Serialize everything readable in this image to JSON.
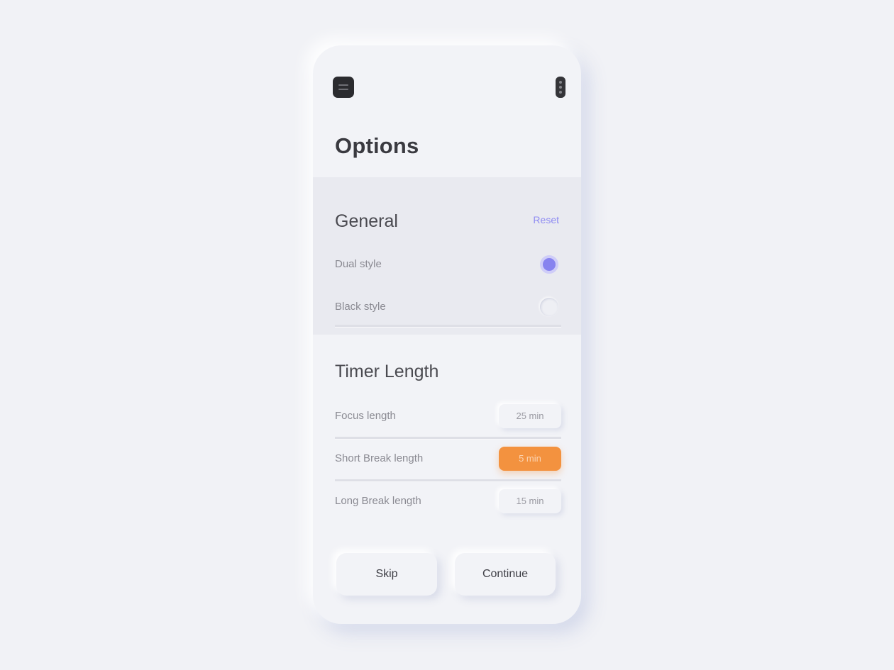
{
  "header": {
    "menu_icon": "hamburger-menu-icon",
    "more_icon": "vertical-dots-icon",
    "title": "Options"
  },
  "general": {
    "title": "General",
    "reset_label": "Reset",
    "options": [
      {
        "label": "Dual style",
        "selected": true
      },
      {
        "label": "Black style",
        "selected": false
      }
    ]
  },
  "timer": {
    "title": "Timer Length",
    "rows": [
      {
        "label": "Focus length",
        "value": "25 min",
        "active": false
      },
      {
        "label": "Short Break length",
        "value": "5 min",
        "active": true
      },
      {
        "label": "Long Break length",
        "value": "15 min",
        "active": false
      }
    ]
  },
  "actions": {
    "skip_label": "Skip",
    "continue_label": "Continue"
  },
  "colors": {
    "accent_purple": "#8783ef",
    "accent_orange": "#f3923f",
    "background": "#f1f2f6"
  }
}
